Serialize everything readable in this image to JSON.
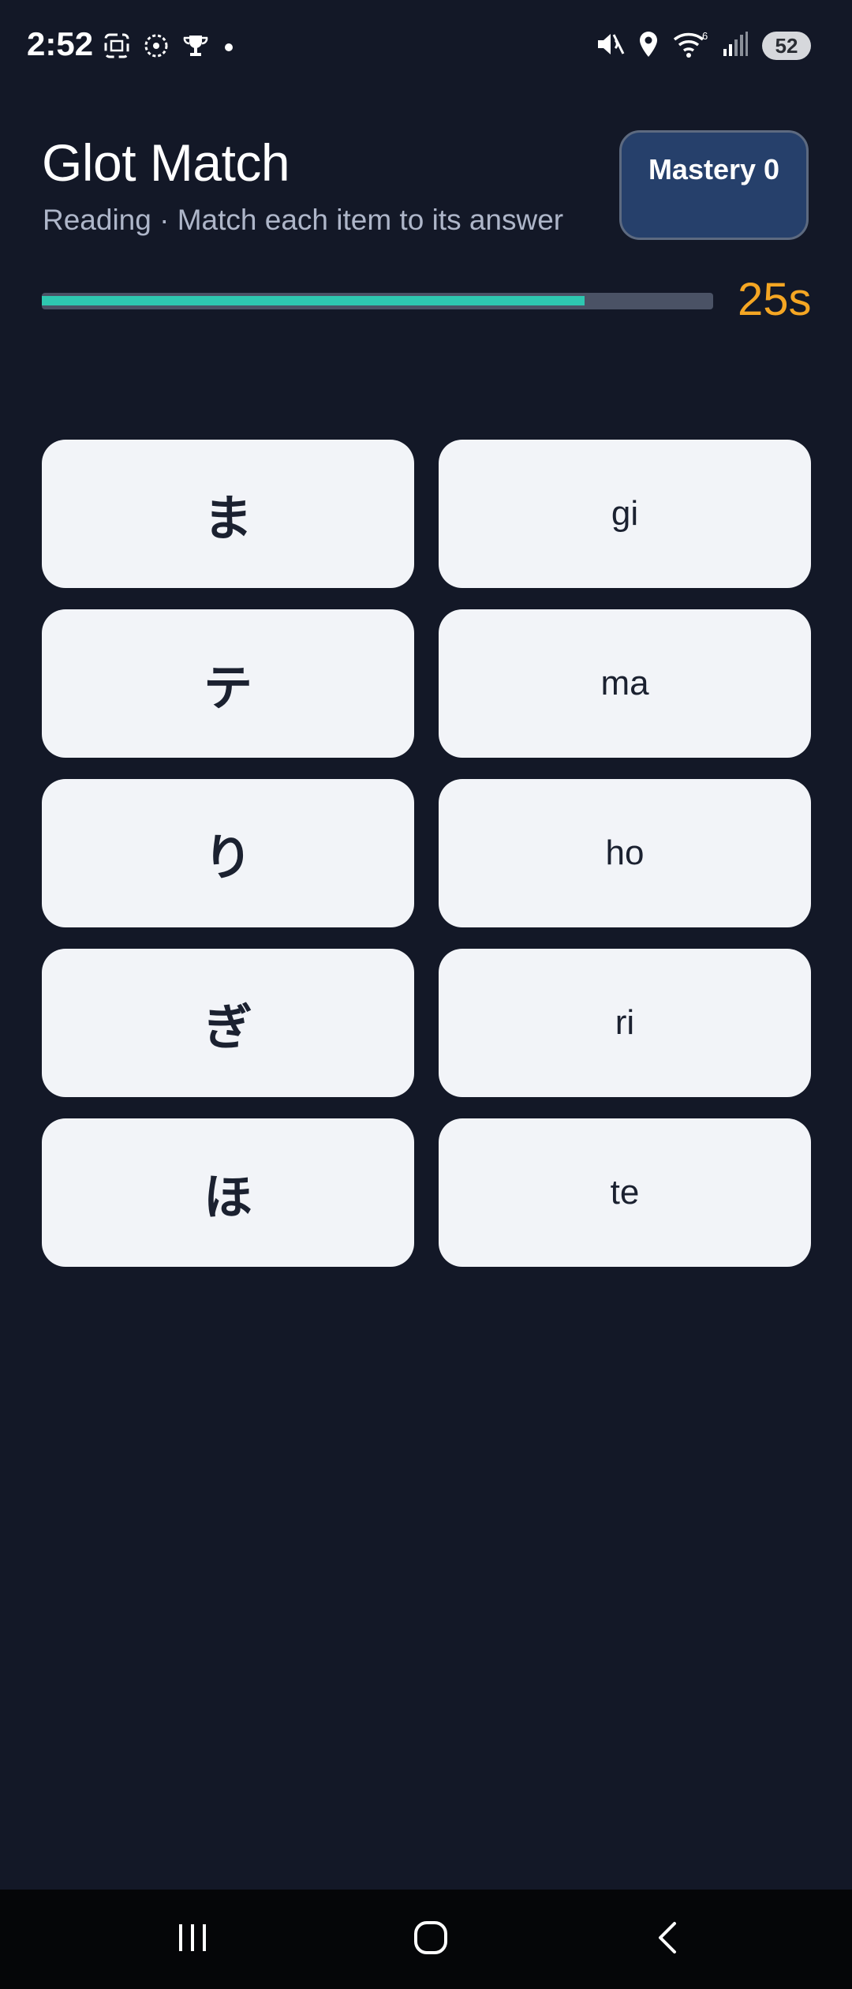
{
  "status_bar": {
    "time": "2:52",
    "battery": "52",
    "icons_left": [
      "screenshot-icon",
      "spinner-icon",
      "trophy-icon",
      "dot-icon"
    ],
    "icons_right": [
      "mute-icon",
      "location-icon",
      "wifi-icon",
      "signal-icon",
      "battery-icon"
    ]
  },
  "header": {
    "title": "Glot Match",
    "subtitle": "Reading · Match each item to its answer",
    "mastery_label": "Mastery 0"
  },
  "timer": {
    "remaining_text": "25s",
    "progress_fraction": 0.808,
    "fill_color": "#2ec7b0",
    "text_color": "#f5a623"
  },
  "tiles": {
    "left": [
      "ま",
      "テ",
      "り",
      "ぎ",
      "ほ"
    ],
    "right": [
      "gi",
      "ma",
      "ho",
      "ri",
      "te"
    ]
  },
  "nav": {
    "buttons": [
      "recent-apps-icon",
      "home-icon",
      "back-icon"
    ]
  }
}
